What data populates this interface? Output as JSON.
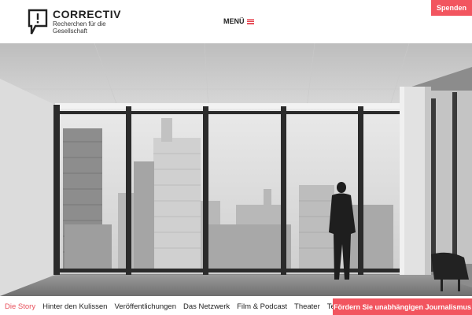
{
  "header": {
    "logo": {
      "name": "CORRECTIV",
      "tagline": "Recherchen für die Gesellschaft"
    },
    "menu_label": "MENÜ",
    "donate_label": "Spenden"
  },
  "hero": {
    "photo": "black-and-white office interior, man looking out over city skyline"
  },
  "nav": {
    "items": [
      {
        "label": "Die Story",
        "active": true
      },
      {
        "label": "Hinter den Kulissen"
      },
      {
        "label": "Veröffentlichungen"
      },
      {
        "label": "Das Netzwerk"
      },
      {
        "label": "Film & Podcast"
      },
      {
        "label": "Theater"
      },
      {
        "label": "Team"
      }
    ],
    "support_label": "Fördern Sie unabhängigen Journalismus"
  },
  "colors": {
    "accent": "#f2555f",
    "text": "#222222"
  }
}
